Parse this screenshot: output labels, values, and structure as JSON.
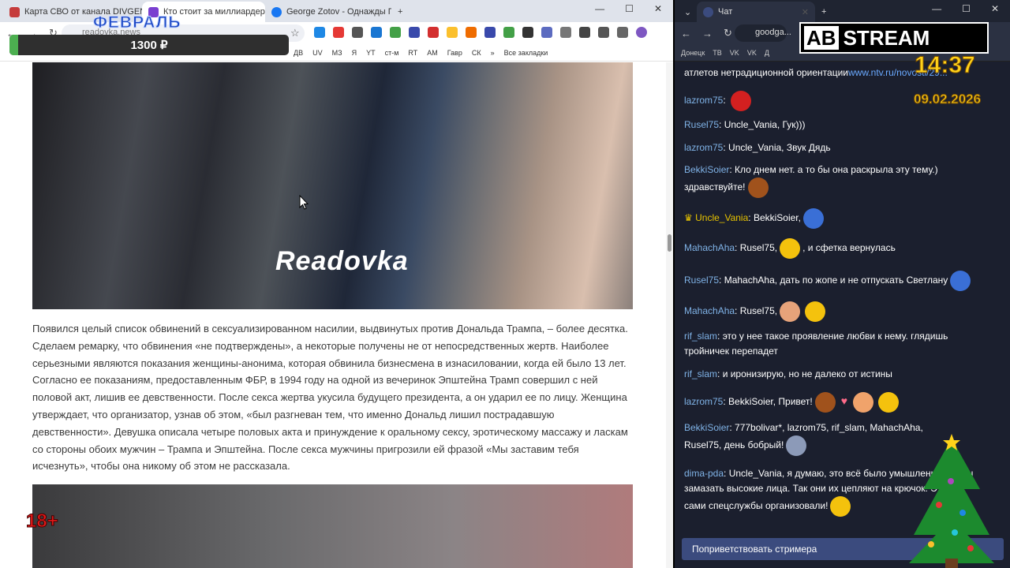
{
  "left_browser": {
    "tabs": [
      {
        "title": "Карта СВО от канала DIVGEN",
        "color": "#c53b3b"
      },
      {
        "title": "Кто стоит за миллиардером-п",
        "color": "#7a3fd0",
        "active": true
      },
      {
        "title": "George Zotov - Однажды Геор",
        "color": "#1877f2"
      }
    ],
    "new_tab": "+",
    "url": "readovka.news",
    "bookmarks": [
      "ДВ",
      "UV",
      "МЗ",
      "Я",
      "YT",
      "ст-м",
      "RT",
      "АМ",
      "Гавр",
      "СК"
    ],
    "all_bookmarks": "Все закладки"
  },
  "donation": {
    "month": "ФЕВРАЛЬ",
    "amount": "1300 ₽",
    "progress": 0.03
  },
  "article": {
    "image_logo": "Readovka",
    "paragraph": "Появился целый список обвинений в сексуализированном насилии, выдвинутых против Дональда Трампа, – более десятка. Сделаем ремарку, что обвинения «не подтверждены», а некоторые получены не от непосредственных жертв. Наиболее серьезными являются показания женщины-анонима, которая обвинила бизнесмена в изнасиловании, когда ей было 13 лет. Согласно ее показаниям, предоставленным ФБР, в 1994 году на одной из вечеринок Эпштейна Трамп совершил с ней половой акт, лишив ее девственности. После секса жертва укусила будущего президента, а он ударил ее по лицу. Женщина утверждает, что организатор, узнав об этом, «был разгневан тем, что именно Дональд лишил пострадавшую девственности». Девушка описала четыре половых акта и принуждение к оральному сексу, эротическому массажу и ласкам со стороны обоих мужчин – Трампа и Эпштейна. После секса мужчины пригрозили ей фразой «Мы заставим тебя исчезнуть», чтобы она никому об этом не рассказала.",
    "age_badge": "18+"
  },
  "right_browser": {
    "tab_title": "Чат",
    "url": "goodga...",
    "bookmarks": [
      "Донецк",
      "ТВ",
      "VK",
      "VK",
      "Д"
    ]
  },
  "overlay": {
    "brand_ab": "AB",
    "brand_text": "STREAM",
    "clock": "14:37",
    "date": "09.02.2026"
  },
  "chat": {
    "top_line": "атлетов нетрадиционной ориентации",
    "top_link": "www.ntv.ru/novosti/29...",
    "messages": [
      {
        "nick": "lazrom75",
        "text": ""
      },
      {
        "nick": "Rusel75",
        "text": "Uncle_Vania, Гук)))"
      },
      {
        "nick": "lazrom75",
        "text": "Uncle_Vania, Звук Дядь"
      },
      {
        "nick": "BekkiSoier",
        "text": "Кло днем нет. а то бы она раскрыла эту тему.) здравствуйте!"
      },
      {
        "nick": "Uncle_Vania",
        "text": "BekkiSoier,"
      },
      {
        "nick": "MahachAha",
        "text": "Rusel75,",
        "text2": ", и сфетка вернулась"
      },
      {
        "nick": "Rusel75",
        "text": "MahachAha, дать по жопе и не отпускать Светлану"
      },
      {
        "nick": "MahachAha",
        "text": "Rusel75,"
      },
      {
        "nick": "rif_slam",
        "text": "это у нее такое проявление любви к нему. глядишь тройничек перепадет"
      },
      {
        "nick": "rif_slam",
        "text": "и иронизирую, но не далеко от истины"
      },
      {
        "nick": "lazrom75",
        "text": "BekkiSoier, Привет!"
      },
      {
        "nick": "BekkiSoier",
        "text": "777bolivar*, lazrom75, rif_slam, MahachAha, Rusel75, день бобрый!"
      },
      {
        "nick": "dima-pda",
        "text": "Uncle_Vania, я думаю, это всё было умышленно, чтобы замазать высокие лица. Так они их цепляют на крючок. Это не сами спецслужбы организовали!"
      }
    ],
    "greet_button": "Поприветствовать стримера"
  }
}
